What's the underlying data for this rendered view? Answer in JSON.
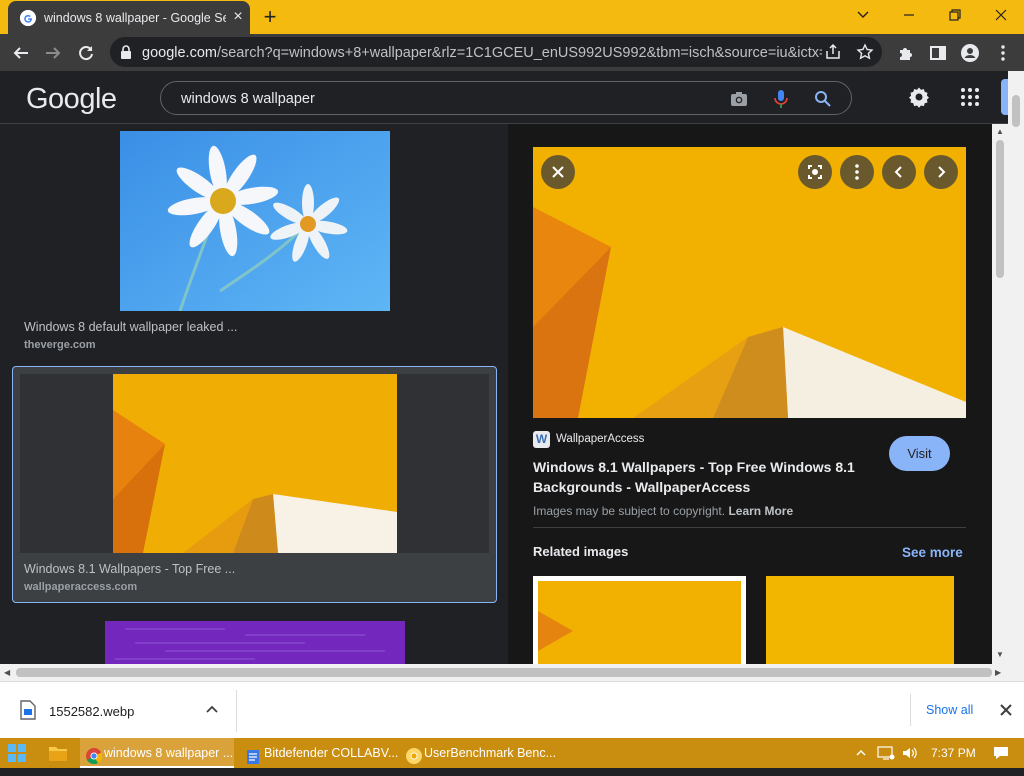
{
  "browser": {
    "tab_title": "windows 8 wallpaper - Google Se",
    "url_host": "google.com",
    "url_path": "/search?q=windows+8+wallpaper&rlz=1C1GCEU_enUS992US992&tbm=isch&source=iu&ictx=..."
  },
  "google": {
    "logo": "Google",
    "query": "windows 8 wallpaper"
  },
  "results": [
    {
      "caption": "Windows 8 default wallpaper leaked ...",
      "source": "theverge.com"
    },
    {
      "caption": "Windows 8.1 Wallpapers - Top Free ...",
      "source": "wallpaperaccess.com"
    }
  ],
  "preview": {
    "site_name": "WallpaperAccess",
    "site_logo_letter": "W",
    "title_line1": "Windows 8.1 Wallpapers - Top Free Windows 8.1",
    "title_line2": "Backgrounds - WallpaperAccess",
    "visit_label": "Visit",
    "copyright": "Images may be subject to copyright.",
    "learn_more": "Learn More",
    "related_heading": "Related images",
    "see_more": "See more"
  },
  "download_bar": {
    "file_name": "1552582.webp",
    "show_all": "Show all"
  },
  "taskbar": {
    "items": [
      {
        "label": "windows 8 wallpaper ..."
      },
      {
        "label": "Bitdefender COLLABV..."
      },
      {
        "label": "UserBenchmark Benc..."
      }
    ],
    "time": "7:37 PM"
  },
  "colors": {
    "title_bar": "#f5ba10",
    "accent_blue": "#8ab4f8",
    "wallpaper_orange": "#f2b100",
    "taskbar": "#c98d10"
  }
}
